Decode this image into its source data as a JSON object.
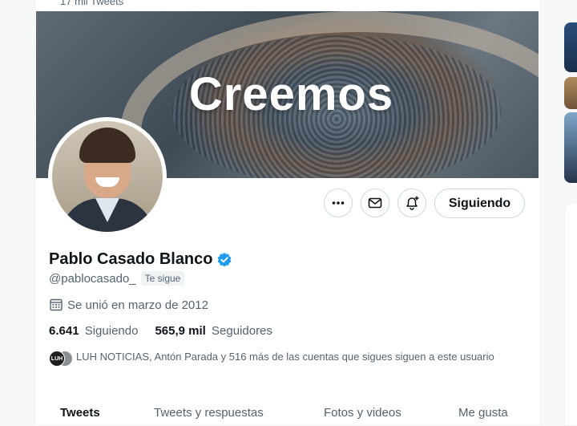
{
  "header": {
    "tweets_count": "17 mil Tweets"
  },
  "banner": {
    "text": "Creemos"
  },
  "actions": {
    "more_label": "Más",
    "message_label": "Mensaje",
    "notify_label": "Activar notificaciones",
    "follow_label": "Siguiendo"
  },
  "profile": {
    "name": "Pablo Casado Blanco",
    "handle": "@pablocasado_",
    "follows_you": "Te sigue",
    "joined": "Se unió en marzo de 2012",
    "following_count": "6.641",
    "following_label": "Siguiendo",
    "followers_count": "565,9 mil",
    "followers_label": "Seguidores",
    "known_followers_text": "LUH NOTICIAS, Antón Parada y 516 más de las cuentas que sigues siguen a este usuario",
    "mini_avatar_text": "LUH"
  },
  "tabs": [
    "Tweets",
    "Tweets y respuestas",
    "Fotos y videos",
    "Me gusta"
  ],
  "colors": {
    "accent": "#1d9bf0",
    "text": "#0f1419",
    "muted": "#536471"
  }
}
